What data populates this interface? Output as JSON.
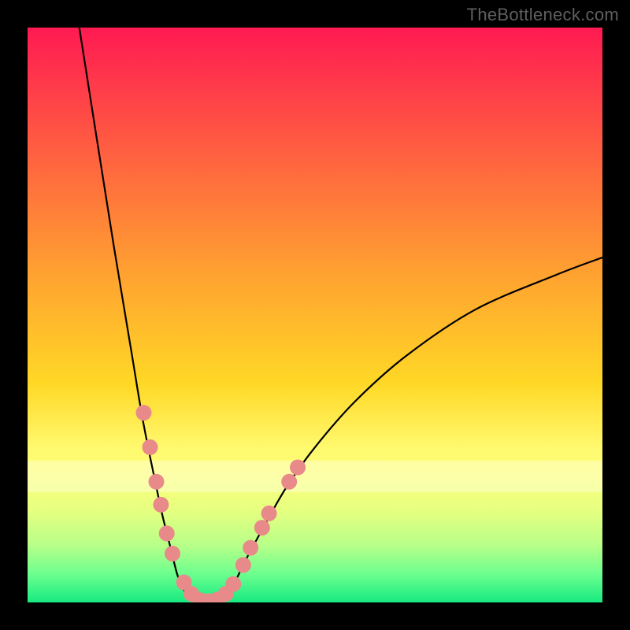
{
  "watermark": "TheBottleneck.com",
  "chart_data": {
    "type": "line",
    "title": "",
    "xlabel": "",
    "ylabel": "",
    "xlim": [
      0,
      100
    ],
    "ylim": [
      0,
      100
    ],
    "grid": false,
    "legend": false,
    "series": [
      {
        "name": "left-arm",
        "x": [
          9,
          15,
          18,
          20,
          22,
          23.5,
          25,
          26,
          27,
          28
        ],
        "y": [
          100,
          62,
          44,
          32,
          22,
          15,
          9,
          5,
          2.5,
          1
        ]
      },
      {
        "name": "valley-floor",
        "x": [
          28,
          29.5,
          31,
          32.5,
          34
        ],
        "y": [
          1,
          0.2,
          0,
          0.2,
          1
        ]
      },
      {
        "name": "right-arm",
        "x": [
          34,
          36,
          38,
          41,
          45,
          50,
          57,
          66,
          78,
          92,
          100
        ],
        "y": [
          1,
          3.5,
          7.5,
          13,
          20,
          27,
          35,
          43,
          51,
          57,
          60
        ]
      }
    ],
    "markers": {
      "name": "scatter-dots",
      "color": "#e88a8a",
      "points": [
        {
          "x": 20.2,
          "y": 33
        },
        {
          "x": 21.3,
          "y": 27
        },
        {
          "x": 22.4,
          "y": 21
        },
        {
          "x": 23.2,
          "y": 17
        },
        {
          "x": 24.2,
          "y": 12
        },
        {
          "x": 25.2,
          "y": 8.5
        },
        {
          "x": 27.2,
          "y": 3.5
        },
        {
          "x": 28.5,
          "y": 1.5
        },
        {
          "x": 30.0,
          "y": 0.4
        },
        {
          "x": 31.5,
          "y": 0.2
        },
        {
          "x": 33.0,
          "y": 0.5
        },
        {
          "x": 34.5,
          "y": 1.5
        },
        {
          "x": 35.8,
          "y": 3.2
        },
        {
          "x": 37.5,
          "y": 6.5
        },
        {
          "x": 38.8,
          "y": 9.5
        },
        {
          "x": 40.8,
          "y": 13
        },
        {
          "x": 42.0,
          "y": 15.5
        },
        {
          "x": 45.5,
          "y": 21
        },
        {
          "x": 47.0,
          "y": 23.5
        }
      ]
    },
    "background_gradient": {
      "top": "#ff1a52",
      "bottom": "#17ea81",
      "description": "vertical red-to-green heatmap gradient"
    }
  }
}
